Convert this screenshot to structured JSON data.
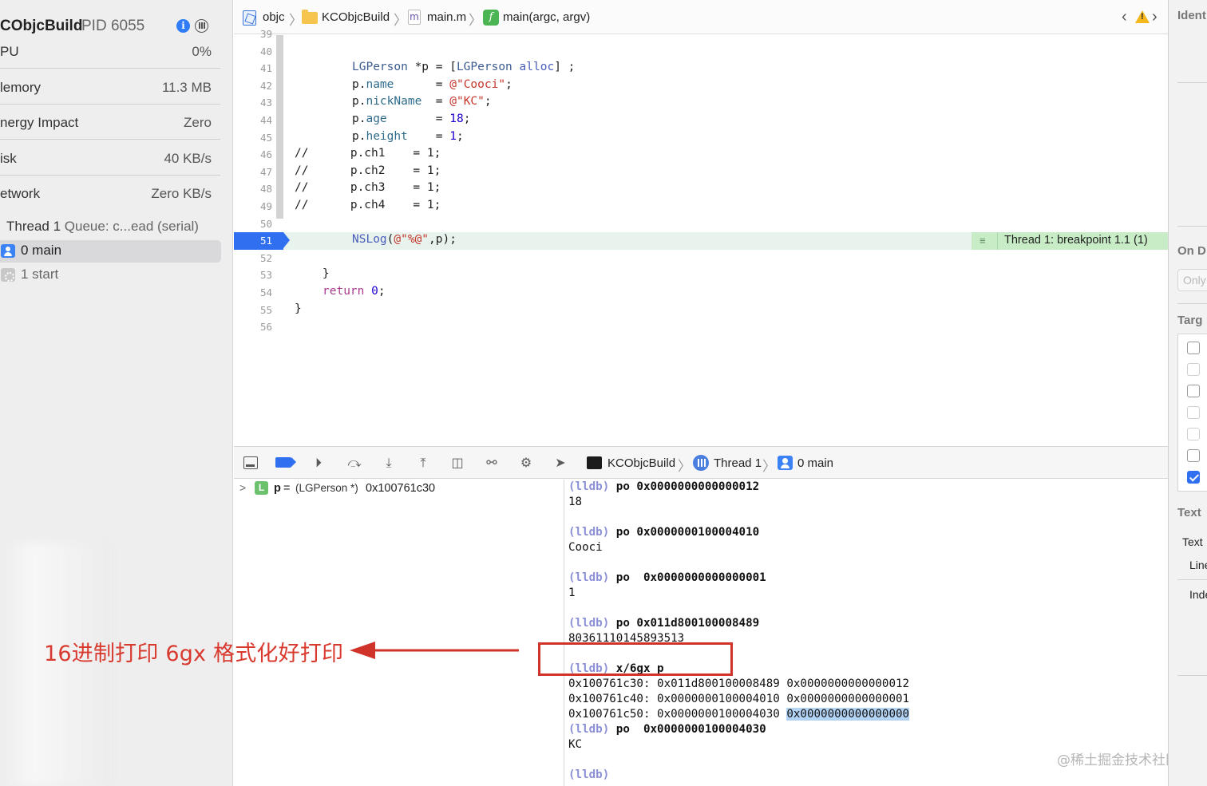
{
  "navigator": {
    "process_name": "CObjcBuild",
    "pid_label": "PID 6055",
    "gauges": [
      {
        "label": "PU",
        "value": "0%"
      },
      {
        "label": "lemory",
        "value": "11.3 MB"
      },
      {
        "label": "nergy Impact",
        "value": "Zero"
      },
      {
        "label": "isk",
        "value": "40 KB/s"
      },
      {
        "label": "etwork",
        "value": "Zero KB/s"
      }
    ],
    "thread_name": "Thread 1",
    "thread_queue": "Queue: c...ead (serial)",
    "frames": [
      {
        "label": "0 main",
        "selected": true
      },
      {
        "label": "1 start",
        "selected": false
      }
    ]
  },
  "annotation": {
    "text": "16进制打印 6gx 格式化好打印",
    "color": "#d93a2f"
  },
  "jumpbar": {
    "project": "objc",
    "folder": "KCObjcBuild",
    "file_icon_letter": "m",
    "file": "main.m",
    "function_icon_letter": "f",
    "function": "main(argc, argv)"
  },
  "editor": {
    "partial_top_number": "39",
    "lines": [
      {
        "n": "40"
      },
      {
        "n": "41"
      },
      {
        "n": "42"
      },
      {
        "n": "43"
      },
      {
        "n": "44"
      },
      {
        "n": "45"
      },
      {
        "n": "46"
      },
      {
        "n": "47"
      },
      {
        "n": "48"
      },
      {
        "n": "49"
      },
      {
        "n": "50"
      },
      {
        "n": "51"
      },
      {
        "n": "52"
      },
      {
        "n": "53"
      },
      {
        "n": "54"
      },
      {
        "n": "55"
      },
      {
        "n": "56"
      }
    ],
    "tokens": {
      "l41_type": "LGPerson",
      "l41_rest1": " *p = [",
      "l41_cls": "LGPerson",
      "l41_sp": " ",
      "l41_alloc": "alloc",
      "l41_end": "] ;",
      "l42_p": "p.",
      "l42_prop": "name",
      "l42_eq": "      = ",
      "l42_str": "@\"Cooci\"",
      "l42_end": ";",
      "l43_p": "p.",
      "l43_prop": "nickName",
      "l43_eq": "  = ",
      "l43_str": "@\"KC\"",
      "l43_end": ";",
      "l44_p": "p.",
      "l44_prop": "age",
      "l44_eq": "       = ",
      "l44_num": "18",
      "l44_end": ";",
      "l45_p": "p.",
      "l45_prop": "height",
      "l45_eq": "    = ",
      "l45_num": "1",
      "l45_end": ";",
      "l46": "//      p.ch1    = 1;",
      "l47": "//      p.ch2    = 1;",
      "l48": "//      p.ch3    = 1;",
      "l49": "//      p.ch4    = 1;",
      "l51_fn": "NSLog",
      "l51_open": "(",
      "l51_str": "@\"%@\"",
      "l51_rest": ",p);",
      "l53": "    }",
      "l54_kw": "return",
      "l54_sp": " ",
      "l54_num": "0",
      "l54_end": ";",
      "l55": "}"
    },
    "breakpoint_line": "51",
    "breakpoint_badge": "Thread 1: breakpoint 1.1 (1)"
  },
  "debugbar": {
    "target": "KCObjcBuild",
    "thread": "Thread 1",
    "frame": "0 main"
  },
  "variables": [
    {
      "badge": "L",
      "name": "p",
      "eq": "=",
      "type": "(LGPerson *)",
      "value": "0x100761c30"
    }
  ],
  "console": {
    "prompt": "(lldb)",
    "lines": {
      "c1_cmd": "po 0x0000000000000012",
      "c1_out": "18",
      "c2_cmd": "po 0x0000000100004010",
      "c2_out": "Cooci",
      "c3_cmd": "po  0x0000000000000001",
      "c3_out": "1",
      "c4_cmd": "po 0x011d800100008489",
      "c4_out": "80361110145893513",
      "c5_cmd": "x/6gx p",
      "m1": "0x100761c30: 0x011d800100008489 0x0000000000000012",
      "m2": "0x100761c40: 0x0000000100004010 0x0000000000000001",
      "m3_a": "0x100761c50: 0x0000000100004030 ",
      "m3_b": "0x0000000000000000",
      "c6_cmd": "po  0x0000000100004030",
      "c6_out": "KC"
    }
  },
  "watermark": "@稀土掘金技术社区",
  "inspector": {
    "identity_heading": "Ident",
    "on_demand_heading": "On D",
    "on_demand_placeholder": "Only",
    "target_heading": "Targ",
    "text_heading": "Text",
    "text_item1": "Text",
    "text_item2": "Line",
    "text_item3": "Inde",
    "checkboxes": [
      false,
      false,
      false,
      false,
      false,
      false,
      true
    ]
  }
}
